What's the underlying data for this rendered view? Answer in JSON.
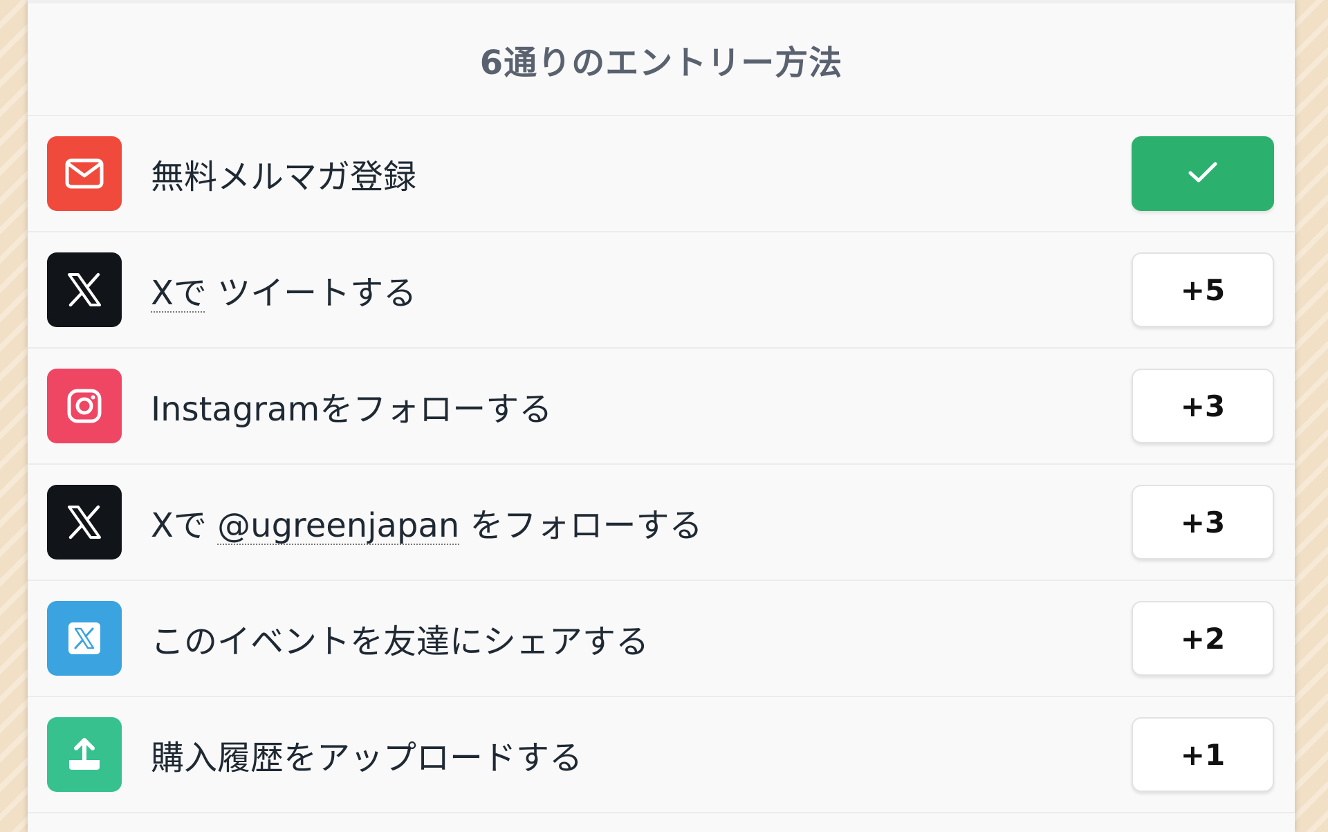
{
  "title": "6通りのエントリー方法",
  "colors": {
    "email_icon_bg": "#f04a3c",
    "x_icon_bg": "#111418",
    "instagram_icon_bg": "#ef4663",
    "share_icon_bg": "#3aa3e0",
    "upload_icon_bg": "#36c18f",
    "completed_button": "#2cb06d"
  },
  "entries": [
    {
      "icon": "envelope-icon",
      "label": "無料メルマガ登録",
      "status": "completed",
      "button_icon": "checkmark-icon"
    },
    {
      "icon": "x-logo-icon",
      "label_link": "Xで",
      "label_rest": " ツイートする",
      "points": "+5"
    },
    {
      "icon": "instagram-icon",
      "label": "Instagramをフォローする",
      "points": "+3"
    },
    {
      "icon": "x-logo-icon",
      "label_prefix": "Xで ",
      "label_link": "@ugreenjapan",
      "label_rest": " をフォローする",
      "points": "+3"
    },
    {
      "icon": "x-share-icon",
      "label": "このイベントを友達にシェアする",
      "points": "+2"
    },
    {
      "icon": "upload-icon",
      "label": "購入履歴をアップロードする",
      "points": "+1"
    }
  ]
}
